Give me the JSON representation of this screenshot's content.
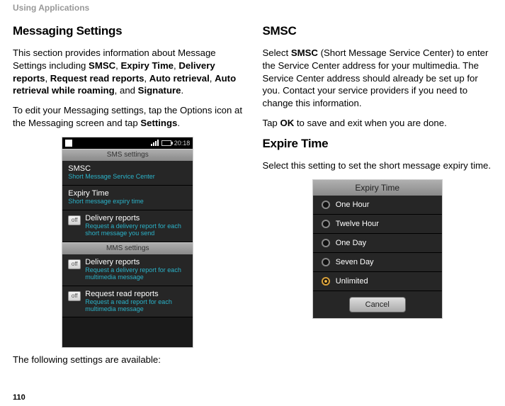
{
  "header": "Using Applications",
  "page_number": "110",
  "left": {
    "title": "Messaging Settings",
    "p1_a": "This section provides information about Message Settings including ",
    "p1_terms": [
      "SMSC",
      "Expiry Time",
      "Delivery reports",
      "Request read reports",
      "Auto retrieval",
      "Auto retrieval while roaming"
    ],
    "p1_sep": ", ",
    "p1_and": ", and ",
    "p1_last": "Signature",
    "p1_end": ".",
    "p2_a": "To edit your Messaging settings, tap the Options icon at the Messaging screen and tap ",
    "p2_bold": "Settings",
    "p2_end": ".",
    "p3": "The following settings are available:",
    "phone": {
      "time": "20:18",
      "sec1": "SMS settings",
      "rows1": [
        {
          "title": "SMSC",
          "sub": "Short Message Service Center",
          "chk": false
        },
        {
          "title": "Expiry Time",
          "sub": "Short message expiry time",
          "chk": false
        },
        {
          "title": "Delivery reports",
          "sub": "Request a delivery report for each short message you send",
          "chk": true
        }
      ],
      "sec2": "MMS settings",
      "rows2": [
        {
          "title": "Delivery reports",
          "sub": "Request a delivery report for each multimedia message",
          "chk": true
        },
        {
          "title": "Request read reports",
          "sub": "Request a read report for each multimedia message",
          "chk": true
        }
      ]
    }
  },
  "right": {
    "sec1_title": "SMSC",
    "sec1_p1_a": "Select ",
    "sec1_p1_bold": "SMSC",
    "sec1_p1_b": " (Short Message Service Center) to enter the Service Center address for your multimedia. The Service Center address should already be set up for you. Contact your service providers if you need to change this information.",
    "sec1_p2_a": "Tap ",
    "sec1_p2_bold": "OK",
    "sec1_p2_b": " to save and exit when you are done.",
    "sec2_title": "Expire Time",
    "sec2_p1": "Select this setting to set the short message expiry time.",
    "dialog": {
      "title": "Expiry Time",
      "options": [
        "One Hour",
        "Twelve Hour",
        "One Day",
        "Seven Day",
        "Unlimited"
      ],
      "selected": 4,
      "cancel": "Cancel"
    }
  }
}
